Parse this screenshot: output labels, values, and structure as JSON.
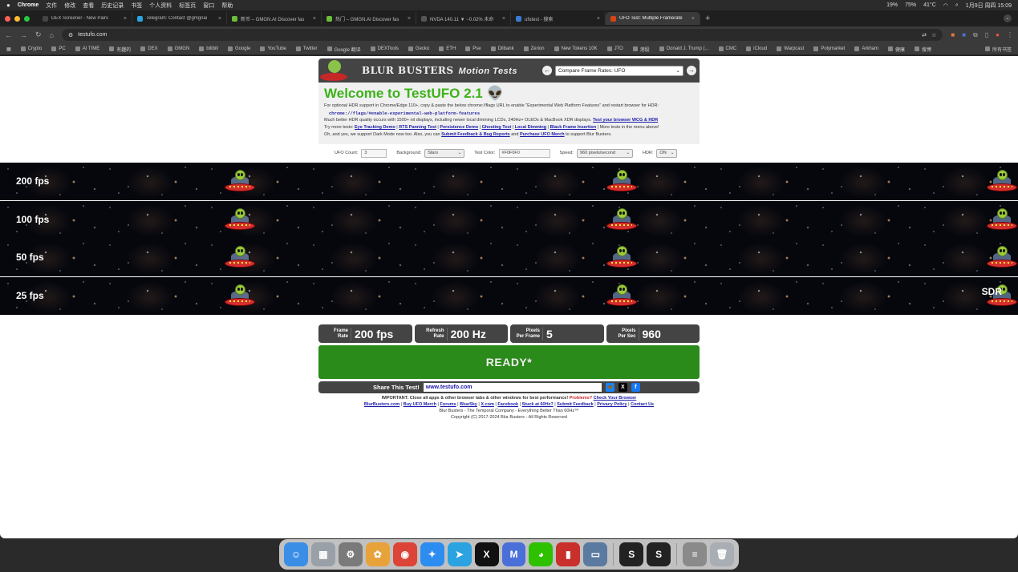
{
  "menubar": {
    "apple": "",
    "app": "Chrome",
    "items": [
      "文件",
      "修改",
      "查看",
      "历史记录",
      "书签",
      "个人资料",
      "标签页",
      "窗口",
      "帮助"
    ],
    "status": [
      "19%",
      "75%",
      "41°C",
      "1月9日 周四 15:09"
    ]
  },
  "tabs": [
    {
      "title": "DEX Screener - New Pairs",
      "color": "#444"
    },
    {
      "title": "Telegram: Contact @gmgnai",
      "color": "#2aa3e0"
    },
    {
      "title": "新币 – GMGN.AI Discover fas",
      "color": "#6bbd3b"
    },
    {
      "title": "热门 – GMGN.AI Discover fas",
      "color": "#6bbd3b"
    },
    {
      "title": "NVDA 140.11 ▼ −0.02% 未命",
      "color": "#555"
    },
    {
      "title": "ufotest - 搜索",
      "color": "#3a7bd5"
    },
    {
      "title": "UFO Test: Multiple Framerate",
      "color": "#d84315",
      "active": true
    }
  ],
  "toolbar": {
    "url": "testufo.com",
    "back": "←",
    "forward": "→",
    "reload": "↻",
    "home": "⌂"
  },
  "bookmarks": [
    "Crypto",
    "PC",
    "AI TIME",
    "有趣的",
    "DEX",
    "GMGN",
    "bilibili",
    "Google",
    "YouTube",
    "Twitter",
    "Google 翻译",
    "DEXTools",
    "Gecko",
    "ETH",
    "Pse",
    "Dilbank",
    "Zerion",
    "New Tokens 10K",
    "JTO",
    "港股",
    "Donald J. Trump (...",
    "CMC",
    "iCloud",
    "Warpcast",
    "Polymarket",
    "Arkham",
    "健康",
    "搜博"
  ],
  "bookmarks_right": "所有书签",
  "header": {
    "brand": "BLUR BUSTERS",
    "brand_sub": "Motion Tests",
    "nav_prev": "←",
    "nav_next": "→",
    "select_value": "Compare Frame Rates: UFO"
  },
  "intro": {
    "title": "Welcome to TestUFO 2.1 👽",
    "line1": "For optional HDR support in Chrome/Edge 110+, copy & paste the below chrome://flags URL to enable \"Experimental Web Platform Features\" and restart browser for HDR:",
    "code": "chrome://flags/#enable-experimental-web-platform-features",
    "line2": "Much better HDR quality occurs with 1500+ nit displays, including newer local dimming LCDs, 240Hz+ OLEDs & MacBook XDR displays.",
    "link_wcg": "Test your browser WCG & HDR",
    "try_more": "Try more tests:",
    "links": [
      "Eye Tracking Demo",
      "RTS Panning Test",
      "Persistence Demo",
      "Ghosting Test",
      "Local Dimming",
      "Black Frame Insertion"
    ],
    "more_tests": "More tests in the menu above!",
    "line4a": "Oh, and yes, we support Dark Mode now too. Also, you can",
    "link_feedback": "Submit Feedback & Bug Reports",
    "and": "and",
    "link_merch": "Purchase UFO Merch",
    "line4b": "to support Blur Busters."
  },
  "controls": {
    "ufo_count_label": "UFO Count:",
    "ufo_count": "3",
    "background_label": "Background:",
    "background": "Stars",
    "test_color_label": "Test Color:",
    "test_color": "#F0F0F0",
    "speed_label": "Speed:",
    "speed": "960 pixels/second",
    "hdr_label": "HDR:",
    "hdr": "ON"
  },
  "lanes": [
    "200 fps",
    "100 fps",
    "50 fps",
    "25 fps"
  ],
  "sdr_label": "SDR",
  "stats": [
    {
      "label1": "Frame",
      "label2": "Rate",
      "value": "200 fps"
    },
    {
      "label1": "Refresh",
      "label2": "Rate",
      "value": "200 Hz"
    },
    {
      "label1": "Pixels",
      "label2": "Per Frame",
      "value": "5"
    },
    {
      "label1": "Pixels",
      "label2": "Per Sec",
      "value": "960"
    }
  ],
  "ready": "READY*",
  "share": {
    "label": "Share This Test!",
    "url": "www.testufo.com",
    "bluesky": "🦋",
    "x": "X",
    "facebook": "f"
  },
  "footer": {
    "important": "IMPORTANT: Close all apps & other browser tabs & other windows for best performance!",
    "problems": "Problems?",
    "check_browser": "Check Your Browser",
    "links": [
      "BlurBusters.com",
      "Buy UFO Merch",
      "Forums",
      "BlueSky",
      "X.com",
      "Facebook",
      "Stuck at 60Hz?",
      "Submit Feedback",
      "Privacy Policy",
      "Contact Us"
    ],
    "tagline": "Blur Busters - The Temporal Company - Everything Better Than 60Hz™",
    "copyright": "Copyright (C) 2017-2024 Blur Busters - All Rights Reserved"
  },
  "dock": [
    {
      "name": "finder",
      "glyph": "☺",
      "color": "#3a8ee6"
    },
    {
      "name": "launchpad",
      "glyph": "▦",
      "color": "#9aa0a8"
    },
    {
      "name": "settings",
      "glyph": "⚙",
      "color": "#7a7a7a"
    },
    {
      "name": "photos",
      "glyph": "✿",
      "color": "#e8a23a"
    },
    {
      "name": "chrome",
      "glyph": "◉",
      "color": "#db4437"
    },
    {
      "name": "safari",
      "glyph": "✦",
      "color": "#2d8cf0"
    },
    {
      "name": "telegram",
      "glyph": "➤",
      "color": "#2aa3e0"
    },
    {
      "name": "x",
      "glyph": "X",
      "color": "#111"
    },
    {
      "name": "mail",
      "glyph": "M",
      "color": "#4a6fd8"
    },
    {
      "name": "wechat",
      "glyph": "◕",
      "color": "#2dc100"
    },
    {
      "name": "notes",
      "glyph": "▮",
      "color": "#c9302c"
    },
    {
      "name": "preview",
      "glyph": "▭",
      "color": "#5a7aa0"
    },
    {
      "name": "s-app-1",
      "glyph": "S",
      "color": "#222"
    },
    {
      "name": "s-app-2",
      "glyph": "S",
      "color": "#222"
    },
    {
      "name": "document",
      "glyph": "≡",
      "color": "#8a8a8a"
    },
    {
      "name": "trash",
      "glyph": "🗑",
      "color": "#a9aeb5"
    }
  ]
}
